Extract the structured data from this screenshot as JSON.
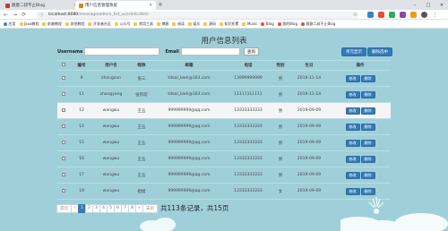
{
  "browser": {
    "tabs": [
      {
        "label": "随意二叔不止Blog",
        "active": false
      },
      {
        "label": "用户信息管理系统",
        "active": true
      }
    ],
    "new_tab_symbol": "+",
    "window_controls": [
      "–",
      "□",
      "✕"
    ],
    "url_host": "localhost:8080",
    "url_path": "/message/admin_list_userInfo.html",
    "bookmarks": [
      {
        "label": "应用",
        "icon": "apps-icon"
      },
      {
        "label": "Java教程",
        "icon": "folder-icon"
      },
      {
        "label": "前端教程",
        "icon": "folder-icon"
      },
      {
        "label": "其他教程",
        "icon": "folder-icon"
      },
      {
        "label": "开发者社区",
        "icon": "folder-icon"
      },
      {
        "label": "公众号",
        "icon": "folder-icon"
      },
      {
        "label": "常用工具",
        "icon": "folder-icon"
      },
      {
        "label": "博客",
        "icon": "folder-icon"
      },
      {
        "label": "阅读",
        "icon": "folder-icon"
      },
      {
        "label": "娱乐",
        "icon": "folder-icon"
      },
      {
        "label": "源码",
        "icon": "folder-icon"
      },
      {
        "label": "知识积累",
        "icon": "folder-icon"
      },
      {
        "label": "Music",
        "icon": "folder-icon"
      },
      {
        "label": "Blog",
        "icon": "site-icon"
      },
      {
        "label": "我的Blog",
        "icon": "site-icon"
      },
      {
        "label": "随意二叔不止Blog",
        "icon": "site-icon"
      }
    ]
  },
  "page": {
    "title": "用户信息列表",
    "search": {
      "username_label": "Username",
      "email_label": "Email",
      "username_value": "",
      "email_value": "",
      "query_button": "查询"
    },
    "batch_button": "单元显示",
    "delete_selected_button": "删除选中",
    "table": {
      "headers": [
        "",
        "编号",
        "用户名",
        "昵称",
        "邮箱",
        "电话",
        "性别",
        "生日",
        "操作"
      ],
      "edit_label": "修改",
      "delete_label": "删除",
      "rows": [
        {
          "id": "9",
          "username": "zhangsan",
          "nickname": "张三",
          "email": "tdeal_bwh@163.com",
          "phone": "13999999999",
          "gender": "男",
          "birthday": "2019-11-14"
        },
        {
          "id": "11",
          "username": "zhangyang",
          "nickname": "张钦皖",
          "email": "tdeal_bwh@163.com",
          "phone": "11111111111",
          "gender": "男",
          "birthday": "2019-11-14"
        },
        {
          "id": "12",
          "username": "wangwu",
          "nickname": "王五",
          "email": "999999999@qq.com",
          "phone": "13333333333",
          "gender": "男",
          "birthday": "2019-09-09"
        },
        {
          "id": "14",
          "username": "wangwu",
          "nickname": "王五",
          "email": "999999999@qq.com",
          "phone": "13333333333",
          "gender": "男",
          "birthday": "2019-09-09"
        },
        {
          "id": "15",
          "username": "wangwu",
          "nickname": "王五",
          "email": "999999999@qq.com",
          "phone": "13333333333",
          "gender": "男",
          "birthday": "2019-09-09"
        },
        {
          "id": "16",
          "username": "wangwu",
          "nickname": "王五",
          "email": "999999999@qq.com",
          "phone": "13333333333",
          "gender": "男",
          "birthday": "2019-09-09"
        },
        {
          "id": "17",
          "username": "wangwu",
          "nickname": "王五",
          "email": "999999999@qq.com",
          "phone": "13333333333",
          "gender": "男",
          "birthday": "2019-09-09"
        },
        {
          "id": "19",
          "username": "wangwu",
          "nickname": "姐姐",
          "email": "999999999@qq.com",
          "phone": "13333333333",
          "gender": "女",
          "birthday": "2019-09-09"
        }
      ],
      "highlighted_row": 2
    },
    "pagination": {
      "first": "首页",
      "prev": "«",
      "pages": [
        "1",
        "2",
        "3",
        "4",
        "5",
        "6",
        "7",
        "8"
      ],
      "current": "1",
      "next": "»",
      "last": "末页",
      "summary": "共113条记录，共15页"
    }
  },
  "colors": {
    "background": "#9fd0da",
    "accent": "#337ab7",
    "row_highlight": "#f5f5f5"
  }
}
